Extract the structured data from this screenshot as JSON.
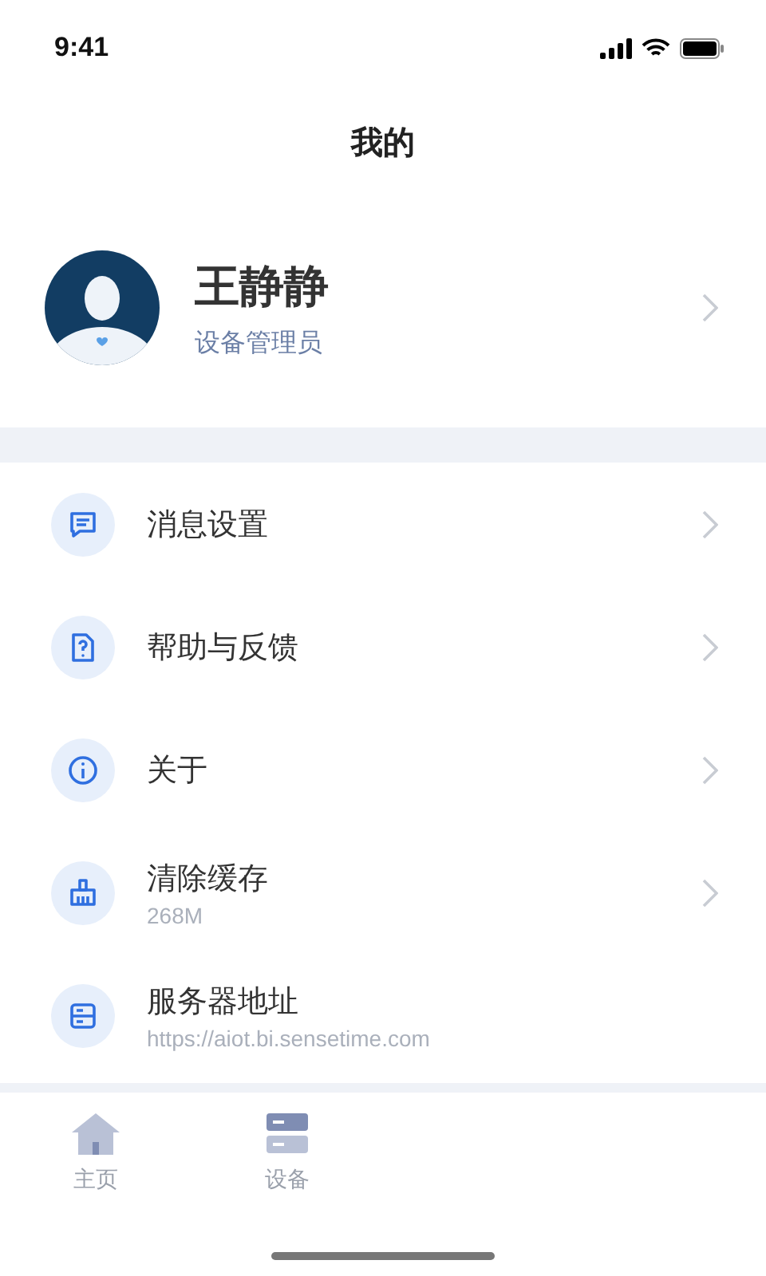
{
  "status_bar": {
    "time": "9:41"
  },
  "title": "我的",
  "profile": {
    "name": "王静静",
    "role": "设备管理员"
  },
  "menu": [
    {
      "kind": "message",
      "label": "消息设置",
      "chevron": true
    },
    {
      "kind": "help",
      "label": "帮助与反馈",
      "chevron": true
    },
    {
      "kind": "info",
      "label": "关于",
      "chevron": true
    },
    {
      "kind": "clean",
      "label": "清除缓存",
      "detail": "268M",
      "chevron": true
    },
    {
      "kind": "server",
      "label": "服务器地址",
      "detail": "https://aiot.bi.sensetime.com",
      "chevron": false
    }
  ],
  "tab_bar": [
    {
      "kind": "home",
      "label": "主页",
      "selected": false
    },
    {
      "kind": "device",
      "label": "设备",
      "selected": false
    }
  ]
}
